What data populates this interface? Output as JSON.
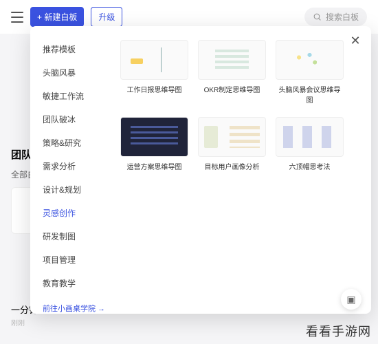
{
  "topbar": {
    "new_board_label": "+ 新建白板",
    "upgrade_label": "升级",
    "search_placeholder": "搜索白板"
  },
  "background": {
    "section_title": "团队",
    "filter_label": "全部白",
    "card_title": "一分钟",
    "card_subtitle": "刚刚"
  },
  "modal": {
    "categories": [
      {
        "label": "推荐模板",
        "active": false
      },
      {
        "label": "头脑风暴",
        "active": false
      },
      {
        "label": "敏捷工作流",
        "active": false
      },
      {
        "label": "团队破冰",
        "active": false
      },
      {
        "label": "策略&研究",
        "active": false
      },
      {
        "label": "需求分析",
        "active": false
      },
      {
        "label": "设计&规划",
        "active": false
      },
      {
        "label": "灵感创作",
        "active": true
      },
      {
        "label": "研发制图",
        "active": false
      },
      {
        "label": "项目管理",
        "active": false
      },
      {
        "label": "教育教学",
        "active": false
      }
    ],
    "academy_link": "前往小画桌学院 →",
    "templates": [
      {
        "title": "工作日报思维导图",
        "thumb": "th-mindmap"
      },
      {
        "title": "OKR制定思维导图",
        "thumb": "th-okr"
      },
      {
        "title": "头脑风暴会议思维导图",
        "thumb": "th-brain"
      },
      {
        "title": "运营方案思维导图",
        "thumb": "th-dark"
      },
      {
        "title": "目标用户画像分析",
        "thumb": "th-persona"
      },
      {
        "title": "六顶帽思考法",
        "thumb": "th-sixhat"
      }
    ]
  },
  "watermark": "看看手游网"
}
